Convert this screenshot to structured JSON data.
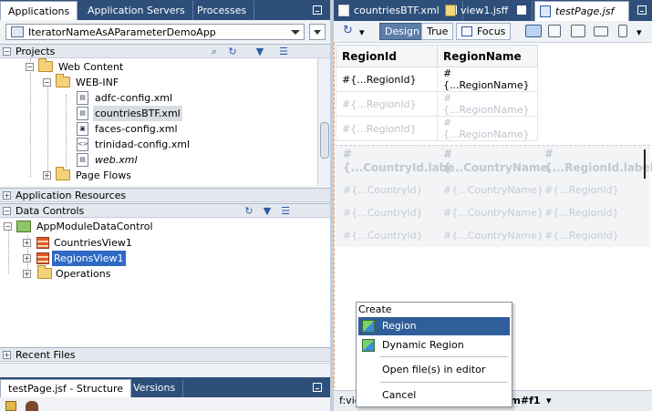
{
  "left_pane": {
    "tabs": [
      "Applications",
      "Application Servers",
      "Processes"
    ],
    "app_selector": "IteratorNameAsAParameterDemoApp",
    "projects_header": "Projects",
    "project_tree": [
      {
        "label": "Web Content",
        "indent": 1,
        "type": "folder",
        "expanded": true
      },
      {
        "label": "WEB-INF",
        "indent": 2,
        "type": "folder",
        "expanded": true
      },
      {
        "label": "adfc-config.xml",
        "indent": 3,
        "type": "file"
      },
      {
        "label": "countriesBTF.xml",
        "indent": 3,
        "type": "file",
        "selected": true
      },
      {
        "label": "faces-config.xml",
        "indent": 3,
        "type": "file"
      },
      {
        "label": "trinidad-config.xml",
        "indent": 3,
        "type": "file"
      },
      {
        "label": "web.xml",
        "indent": 3,
        "type": "file",
        "italic": true
      },
      {
        "label": "Page Flows",
        "indent": 2,
        "type": "folder",
        "expanded": false
      }
    ],
    "app_resources_header": "Application Resources",
    "data_controls_header": "Data Controls",
    "data_controls_tree": [
      {
        "label": "AppModuleDataControl",
        "indent": 0,
        "type": "root"
      },
      {
        "label": "CountriesView1",
        "indent": 1,
        "type": "view"
      },
      {
        "label": "RegionsView1",
        "indent": 1,
        "type": "view",
        "highlighted": true
      },
      {
        "label": "Operations",
        "indent": 1,
        "type": "folder"
      }
    ],
    "recent_files_header": "Recent Files",
    "bottom_tabs": [
      "testPage.jsf - Structure",
      "Versions"
    ]
  },
  "editor": {
    "tabs": [
      {
        "label": "countriesBTF.xml",
        "active": false
      },
      {
        "label": "view1.jsff",
        "active": false
      },
      {
        "label": "testPage.jsf",
        "active": true
      }
    ],
    "toolbar": {
      "design": "Design",
      "true_btn": "True",
      "focus": "Focus"
    },
    "table1": {
      "headers": [
        "RegionId",
        "RegionName"
      ],
      "row1": [
        "#{...RegionId}",
        "#{...RegionName}"
      ],
      "ghost_rows": [
        [
          "#{...RegionId}",
          "#{...RegionName}"
        ],
        [
          "#{...RegionId}",
          "#{...RegionName}"
        ]
      ]
    },
    "table2": {
      "headers": [
        [
          "#",
          "{...CountryId.labe"
        ],
        [
          "#",
          "{...CountryName."
        ],
        [
          "#",
          "{...RegionId.label"
        ]
      ],
      "rows": [
        [
          "#{...CountryId}",
          "#{...CountryName}",
          "#{...RegionId}"
        ],
        [
          "#{...CountryId}",
          "#{...CountryName}",
          "#{...RegionId}"
        ],
        [
          "#{...CountryId}",
          "#{...CountryName}",
          "#{...RegionId}"
        ]
      ]
    },
    "status_left": "f:vie",
    "status_crumb": "rm#f1"
  },
  "context_menu": {
    "header": "Create",
    "items": [
      "Region",
      "Dynamic Region",
      "Open file(s) in editor",
      "Cancel"
    ]
  },
  "colors": {
    "tab_bar": "#2d4f7a",
    "selection": "#2f6bc3",
    "menu_highlight": "#2f5e9a"
  }
}
